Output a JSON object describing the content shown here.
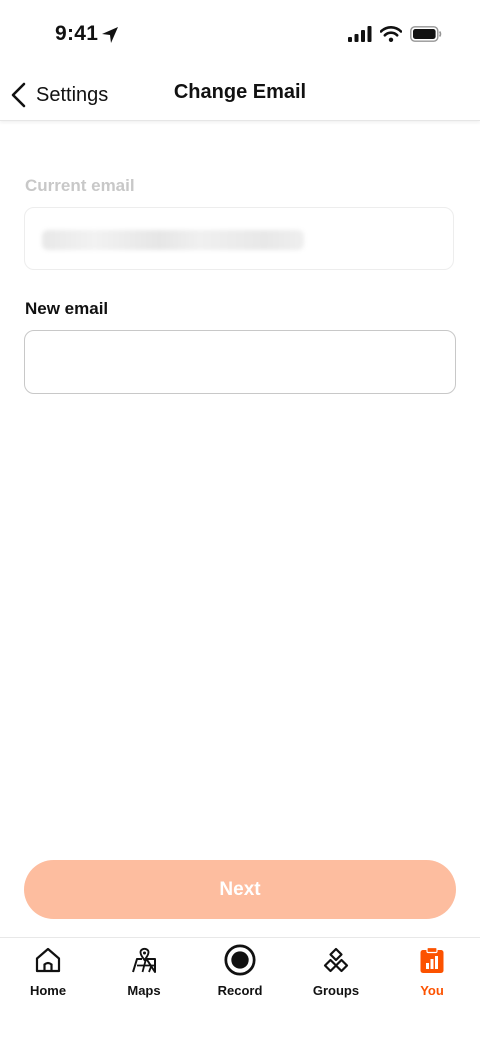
{
  "status_bar": {
    "time": "9:41",
    "icons": [
      "location-arrow-icon",
      "cellular-signal-icon",
      "wifi-icon",
      "battery-icon"
    ]
  },
  "nav": {
    "back_label": "Settings",
    "title": "Change Email"
  },
  "form": {
    "current_email_label": "Current email",
    "current_email_value_redacted": true,
    "new_email_label": "New email",
    "new_email_value": "",
    "next_label": "Next"
  },
  "tabs": [
    {
      "label": "Home",
      "icon": "home-icon",
      "active": false
    },
    {
      "label": "Maps",
      "icon": "map-icon",
      "active": false
    },
    {
      "label": "Record",
      "icon": "record-icon",
      "active": false
    },
    {
      "label": "Groups",
      "icon": "groups-icon",
      "active": false
    },
    {
      "label": "You",
      "icon": "you-icon",
      "active": true
    }
  ],
  "colors": {
    "accent": "#fc5200",
    "button_disabled": "#fdbd9f",
    "label_disabled": "#c8c8c8"
  }
}
